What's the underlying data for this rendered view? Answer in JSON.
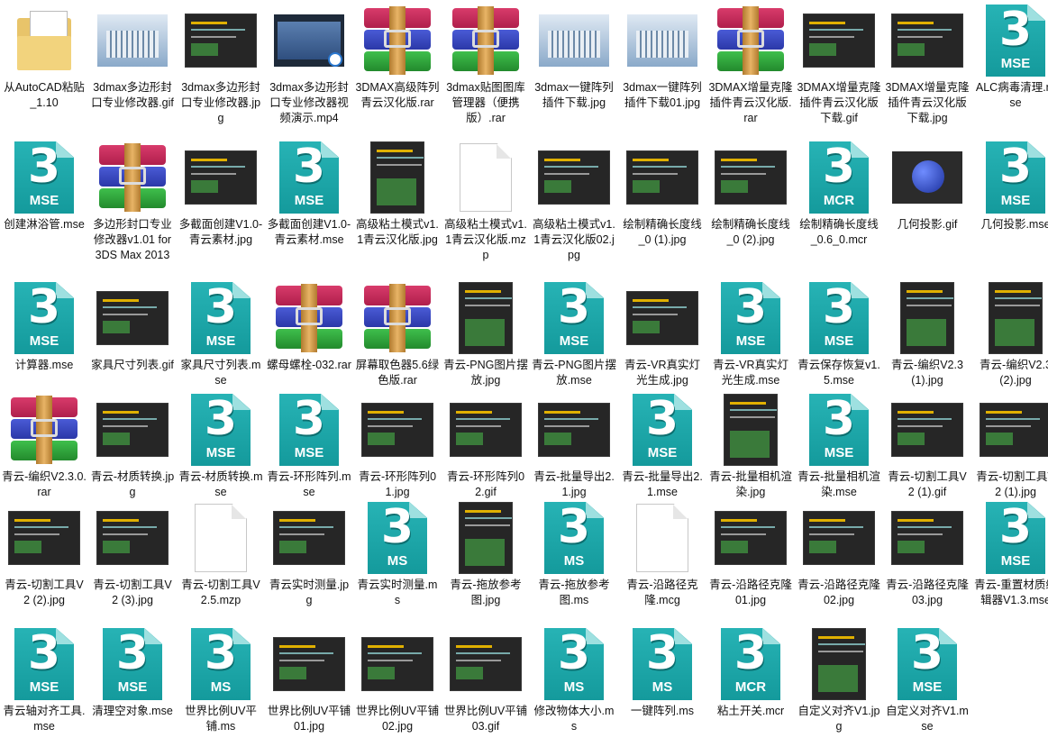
{
  "files": [
    {
      "label": "从AutoCAD粘贴_1.10",
      "icon": "folder-icon",
      "kind": "folder"
    },
    {
      "label": "3dmax多边形封口专业修改器.gif",
      "icon": "image-thumbnail-icon",
      "kind": "img-light"
    },
    {
      "label": "3dmax多边形封口专业修改器.jpg",
      "icon": "image-thumbnail-icon",
      "kind": "img-dark"
    },
    {
      "label": "3dmax多边形封口专业修改器视频演示.mp4",
      "icon": "video-thumbnail-icon",
      "kind": "vid"
    },
    {
      "label": "3DMAX高级阵列青云汉化版.rar",
      "icon": "winrar-archive-icon",
      "kind": "rar"
    },
    {
      "label": "3dmax贴图图库管理器（便携版）.rar",
      "icon": "winrar-archive-icon",
      "kind": "rar"
    },
    {
      "label": "3dmax一键阵列插件下载.jpg",
      "icon": "image-thumbnail-icon",
      "kind": "img-light"
    },
    {
      "label": "3dmax一键阵列插件下载01.jpg",
      "icon": "image-thumbnail-icon",
      "kind": "img-light"
    },
    {
      "label": "3DMAX增量克隆插件青云汉化版.rar",
      "icon": "winrar-archive-icon",
      "kind": "rar"
    },
    {
      "label": "3DMAX增量克隆插件青云汉化版下载.gif",
      "icon": "image-thumbnail-icon",
      "kind": "img-dark"
    },
    {
      "label": "3DMAX增量克隆插件青云汉化版下载.jpg",
      "icon": "image-thumbnail-icon",
      "kind": "img-dark"
    },
    {
      "label": "ALC病毒清理.mse",
      "icon": "maxscript-file-icon",
      "kind": "mse",
      "ext": "MSE"
    },
    {
      "label": "创建淋浴管.mse",
      "icon": "maxscript-file-icon",
      "kind": "mse",
      "ext": "MSE"
    },
    {
      "label": "多边形封口专业修改器v1.01 for 3DS Max 2013 -...",
      "icon": "winrar-archive-icon",
      "kind": "rar"
    },
    {
      "label": "多截面创建V1.0-青云素材.jpg",
      "icon": "image-thumbnail-icon",
      "kind": "img-dark"
    },
    {
      "label": "多截面创建V1.0-青云素材.mse",
      "icon": "maxscript-file-icon",
      "kind": "mse",
      "ext": "MSE"
    },
    {
      "label": "高级粘土模式v1.1青云汉化版.jpg",
      "icon": "image-thumbnail-icon",
      "kind": "img-tall"
    },
    {
      "label": "高级粘土模式v1.1青云汉化版.mzp",
      "icon": "blank-file-icon",
      "kind": "blank"
    },
    {
      "label": "高级粘土模式v1.1青云汉化版02.jpg",
      "icon": "image-thumbnail-icon",
      "kind": "img-dark"
    },
    {
      "label": "绘制精确长度线_0 (1).jpg",
      "icon": "image-thumbnail-icon",
      "kind": "img-dark"
    },
    {
      "label": "绘制精确长度线_0 (2).jpg",
      "icon": "image-thumbnail-icon",
      "kind": "img-dark"
    },
    {
      "label": "绘制精确长度线_0.6_0.mcr",
      "icon": "maxscript-file-icon",
      "kind": "mse",
      "ext": "MCR"
    },
    {
      "label": "几何投影.gif",
      "icon": "image-thumbnail-icon",
      "kind": "img-sphere"
    },
    {
      "label": "几何投影.mse",
      "icon": "maxscript-file-icon",
      "kind": "mse",
      "ext": "MSE"
    },
    {
      "label": "计算器.mse",
      "icon": "maxscript-file-icon",
      "kind": "mse",
      "ext": "MSE"
    },
    {
      "label": "家具尺寸列表.gif",
      "icon": "image-thumbnail-icon",
      "kind": "img-dark"
    },
    {
      "label": "家具尺寸列表.mse",
      "icon": "maxscript-file-icon",
      "kind": "mse",
      "ext": "MSE"
    },
    {
      "label": "螺母螺栓-032.rar",
      "icon": "winrar-archive-icon",
      "kind": "rar"
    },
    {
      "label": "屏幕取色器5.6绿色版.rar",
      "icon": "winrar-archive-icon",
      "kind": "rar"
    },
    {
      "label": "青云-PNG图片摆放.jpg",
      "icon": "image-thumbnail-icon",
      "kind": "img-tall"
    },
    {
      "label": "青云-PNG图片摆放.mse",
      "icon": "maxscript-file-icon",
      "kind": "mse",
      "ext": "MSE"
    },
    {
      "label": "青云-VR真实灯光生成.jpg",
      "icon": "image-thumbnail-icon",
      "kind": "img-dark"
    },
    {
      "label": "青云-VR真实灯光生成.mse",
      "icon": "maxscript-file-icon",
      "kind": "mse",
      "ext": "MSE"
    },
    {
      "label": "青云保存恢复v1.5.mse",
      "icon": "maxscript-file-icon",
      "kind": "mse",
      "ext": "MSE"
    },
    {
      "label": "青云-编织V2.3 (1).jpg",
      "icon": "image-thumbnail-icon",
      "kind": "img-tall"
    },
    {
      "label": "青云-编织V2.3 (2).jpg",
      "icon": "image-thumbnail-icon",
      "kind": "img-tall"
    },
    {
      "label": "青云-编织V2.3.0.rar",
      "icon": "winrar-archive-icon",
      "kind": "rar"
    },
    {
      "label": "青云-材质转换.jpg",
      "icon": "image-thumbnail-icon",
      "kind": "img-dark"
    },
    {
      "label": "青云-材质转换.mse",
      "icon": "maxscript-file-icon",
      "kind": "mse",
      "ext": "MSE"
    },
    {
      "label": "青云-环形阵列.mse",
      "icon": "maxscript-file-icon",
      "kind": "mse",
      "ext": "MSE"
    },
    {
      "label": "青云-环形阵列01.jpg",
      "icon": "image-thumbnail-icon",
      "kind": "img-dark"
    },
    {
      "label": "青云-环形阵列02.gif",
      "icon": "image-thumbnail-icon",
      "kind": "img-dark"
    },
    {
      "label": "青云-批量导出2.1.jpg",
      "icon": "image-thumbnail-icon",
      "kind": "img-dark"
    },
    {
      "label": "青云-批量导出2.1.mse",
      "icon": "maxscript-file-icon",
      "kind": "mse",
      "ext": "MSE"
    },
    {
      "label": "青云-批量相机渲染.jpg",
      "icon": "image-thumbnail-icon",
      "kind": "img-tall"
    },
    {
      "label": "青云-批量相机渲染.mse",
      "icon": "maxscript-file-icon",
      "kind": "mse",
      "ext": "MSE"
    },
    {
      "label": "青云-切割工具V2 (1).gif",
      "icon": "image-thumbnail-icon",
      "kind": "img-dark"
    },
    {
      "label": "青云-切割工具V2 (1).jpg",
      "icon": "image-thumbnail-icon",
      "kind": "img-dark"
    },
    {
      "label": "青云-切割工具V2 (2).jpg",
      "icon": "image-thumbnail-icon",
      "kind": "img-dark"
    },
    {
      "label": "青云-切割工具V2 (3).jpg",
      "icon": "image-thumbnail-icon",
      "kind": "img-dark"
    },
    {
      "label": "青云-切割工具V2.5.mzp",
      "icon": "blank-file-icon",
      "kind": "blank"
    },
    {
      "label": "青云实时测量.jpg",
      "icon": "image-thumbnail-icon",
      "kind": "img-dark"
    },
    {
      "label": "青云实时测量.ms",
      "icon": "maxscript-file-icon",
      "kind": "mse",
      "ext": "MS"
    },
    {
      "label": "青云-拖放参考图.jpg",
      "icon": "image-thumbnail-icon",
      "kind": "img-tall"
    },
    {
      "label": "青云-拖放参考图.ms",
      "icon": "maxscript-file-icon",
      "kind": "mse",
      "ext": "MS"
    },
    {
      "label": "青云-沿路径克隆.mcg",
      "icon": "blank-file-icon",
      "kind": "blank"
    },
    {
      "label": "青云-沿路径克隆01.jpg",
      "icon": "image-thumbnail-icon",
      "kind": "img-dark"
    },
    {
      "label": "青云-沿路径克隆02.jpg",
      "icon": "image-thumbnail-icon",
      "kind": "img-dark"
    },
    {
      "label": "青云-沿路径克隆03.jpg",
      "icon": "image-thumbnail-icon",
      "kind": "img-dark"
    },
    {
      "label": "青云-重置材质编辑器V1.3.mse",
      "icon": "maxscript-file-icon",
      "kind": "mse",
      "ext": "MSE"
    },
    {
      "label": "青云轴对齐工具.mse",
      "icon": "maxscript-file-icon",
      "kind": "mse",
      "ext": "MSE"
    },
    {
      "label": "清理空对象.mse",
      "icon": "maxscript-file-icon",
      "kind": "mse",
      "ext": "MSE"
    },
    {
      "label": "世界比例UV平铺.ms",
      "icon": "maxscript-file-icon",
      "kind": "mse",
      "ext": "MS"
    },
    {
      "label": "世界比例UV平铺01.jpg",
      "icon": "image-thumbnail-icon",
      "kind": "img-dark"
    },
    {
      "label": "世界比例UV平铺02.jpg",
      "icon": "image-thumbnail-icon",
      "kind": "img-dark"
    },
    {
      "label": "世界比例UV平铺03.gif",
      "icon": "image-thumbnail-icon",
      "kind": "img-dark"
    },
    {
      "label": "修改物体大小.ms",
      "icon": "maxscript-file-icon",
      "kind": "mse",
      "ext": "MS"
    },
    {
      "label": "一键阵列.ms",
      "icon": "maxscript-file-icon",
      "kind": "mse",
      "ext": "MS"
    },
    {
      "label": "粘土开关.mcr",
      "icon": "maxscript-file-icon",
      "kind": "mse",
      "ext": "MCR"
    },
    {
      "label": "自定义对齐V1.jpg",
      "icon": "image-thumbnail-icon",
      "kind": "img-tall"
    },
    {
      "label": "自定义对齐V1.mse",
      "icon": "maxscript-file-icon",
      "kind": "mse",
      "ext": "MSE"
    }
  ]
}
